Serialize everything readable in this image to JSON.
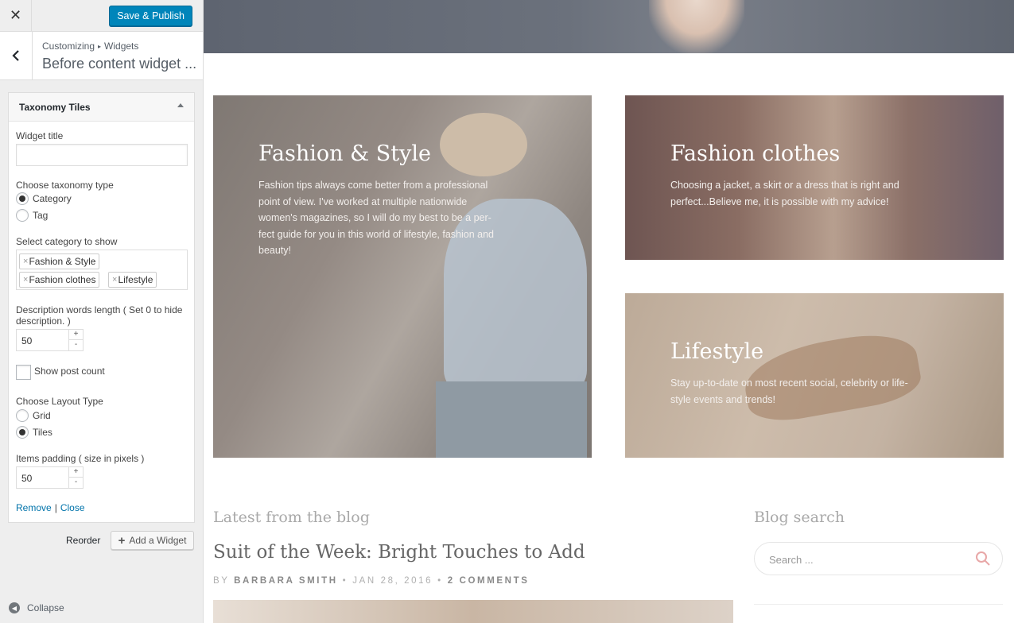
{
  "customizer": {
    "close_glyph": "✕",
    "save_label": "Save & Publish",
    "breadcrumb": [
      "Customizing",
      "Widgets"
    ],
    "breadcrumb_separator": "▸",
    "section_title": "Before content widget ...",
    "widget": {
      "title": "Taxonomy Tiles",
      "widget_title_label": "Widget title",
      "widget_title_value": "",
      "taxonomy_type_label": "Choose taxonomy type",
      "taxonomy_options": [
        {
          "label": "Category",
          "selected": true
        },
        {
          "label": "Tag",
          "selected": false
        }
      ],
      "select_category_label": "Select category to show",
      "selected_categories": [
        "Fashion & Style",
        "Fashion clothes",
        "Lifestyle"
      ],
      "description_length_label": "Description words length ( Set 0 to hide description. )",
      "description_length_value": "50",
      "show_post_count_label": "Show post count",
      "show_post_count_checked": false,
      "layout_type_label": "Choose Layout Type",
      "layout_options": [
        {
          "label": "Grid",
          "selected": false
        },
        {
          "label": "Tiles",
          "selected": true
        }
      ],
      "items_padding_label": "Items padding ( size in pixels )",
      "items_padding_value": "50",
      "remove_label": "Remove",
      "link_separator": "|",
      "close_label": "Close"
    },
    "reorder_label": "Reorder",
    "add_widget_label": "Add a Widget",
    "collapse_label": "Collapse",
    "accent_color": "#0085ba"
  },
  "preview": {
    "tiles": [
      {
        "title": "Fashion & Style",
        "description_lines": [
          "Fashion tips always come better from a professional",
          "point of view. I've worked at multiple nationwide",
          "women's magazines, so I will do my best to be a per-",
          "fect guide for you in this world of lifestyle, fashion and",
          "beauty!"
        ]
      },
      {
        "title": "Fashion clothes",
        "description_lines": [
          "Choosing a jacket, a skirt or a dress that is right and",
          "perfect...Believe me, it is possible with my advice!"
        ]
      },
      {
        "title": "Lifestyle",
        "description_lines": [
          "Stay up-to-date on most recent social, celebrity or life-",
          "style events and trends!"
        ]
      }
    ],
    "latest_heading": "Latest from the blog",
    "post": {
      "title": "Suit of the Week: Bright Touches to Add",
      "by": "BY",
      "author": "BARBARA SMITH",
      "date": "JAN 28, 2016",
      "comments": "2 COMMENTS",
      "meta_separator": "•"
    },
    "blog_search_heading": "Blog search",
    "search_placeholder": "Search ..."
  }
}
